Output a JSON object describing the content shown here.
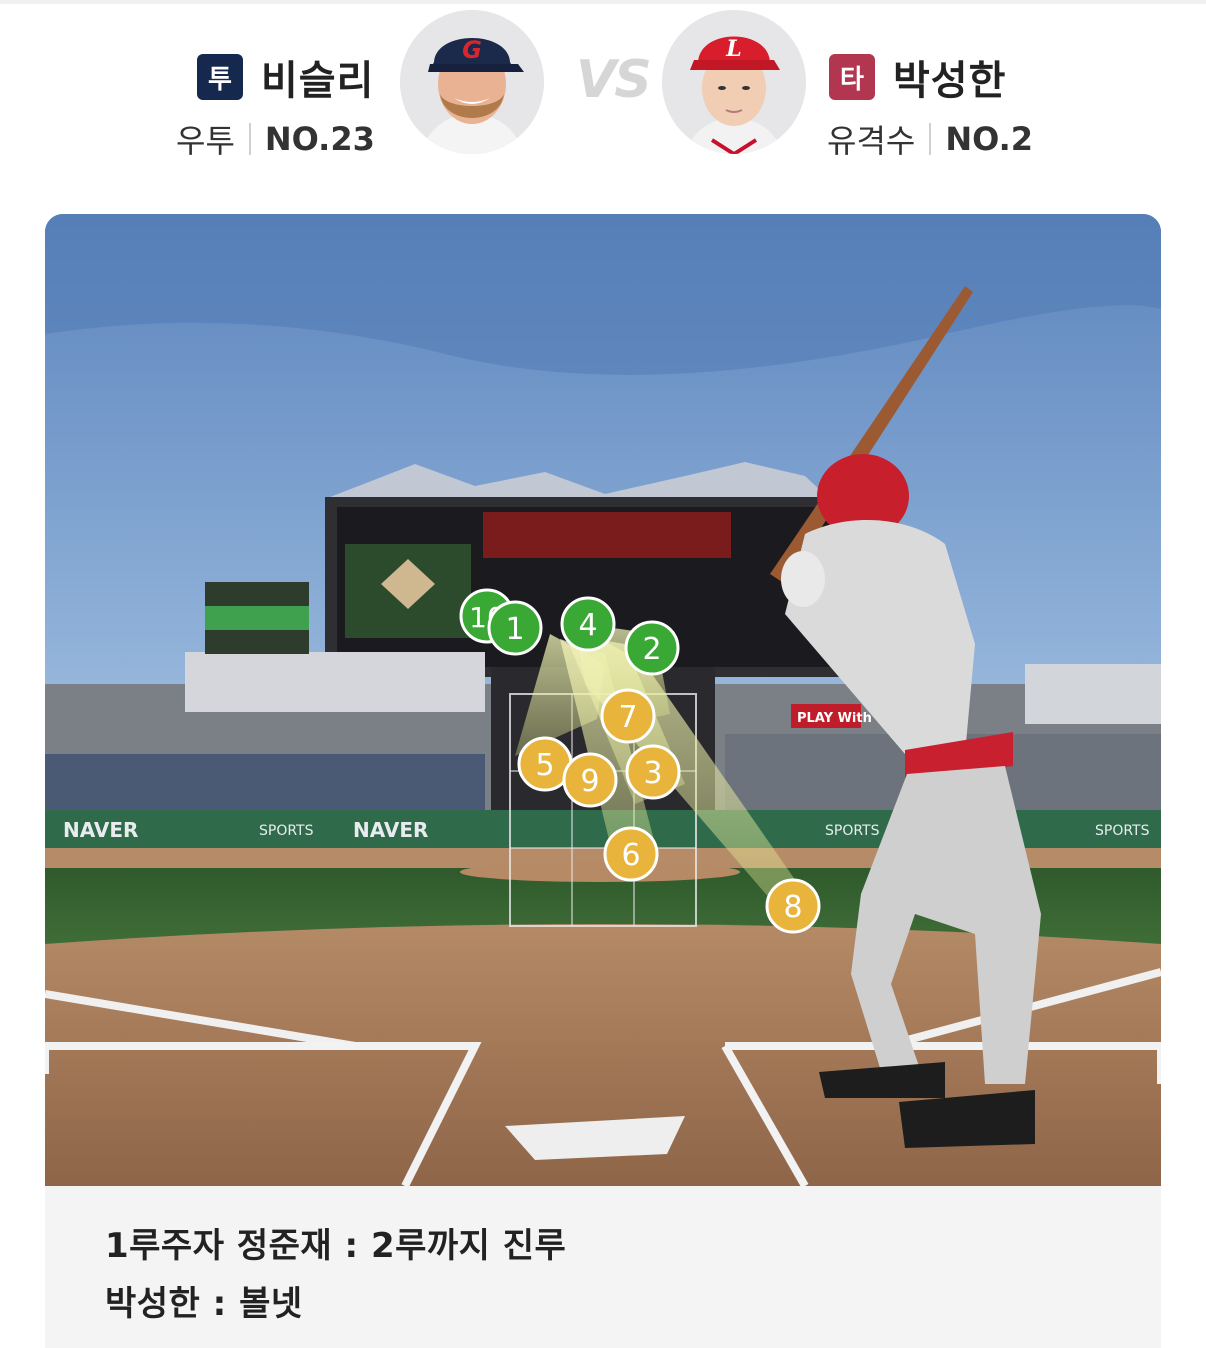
{
  "pitcher": {
    "position_badge": "투",
    "name": "비슬리",
    "throw_hand": "우투",
    "number": "NO.23"
  },
  "batter": {
    "position_badge": "타",
    "name": "박성한",
    "role": "유격수",
    "number": "NO.2"
  },
  "vs_label": "VS",
  "pitches": [
    {
      "label": "10",
      "color": "green"
    },
    {
      "label": "1",
      "color": "green"
    },
    {
      "label": "4",
      "color": "green"
    },
    {
      "label": "2",
      "color": "green"
    },
    {
      "label": "7",
      "color": "orange"
    },
    {
      "label": "5",
      "color": "orange"
    },
    {
      "label": "9",
      "color": "orange"
    },
    {
      "label": "3",
      "color": "orange"
    },
    {
      "label": "6",
      "color": "orange"
    },
    {
      "label": "8",
      "color": "orange"
    }
  ],
  "ad_boards": {
    "naver": "NAVER",
    "naver_sports": "SPORTS",
    "play_with": "PLAY With"
  },
  "result": {
    "line1": "1루주자 정준재 : 2루까지 진루",
    "line2": "박성한 : 볼넷"
  },
  "colors": {
    "pitcher_badge": "#15284d",
    "batter_badge": "#b2364f",
    "ball_green": "#3aa835",
    "ball_orange": "#e8b43c"
  }
}
